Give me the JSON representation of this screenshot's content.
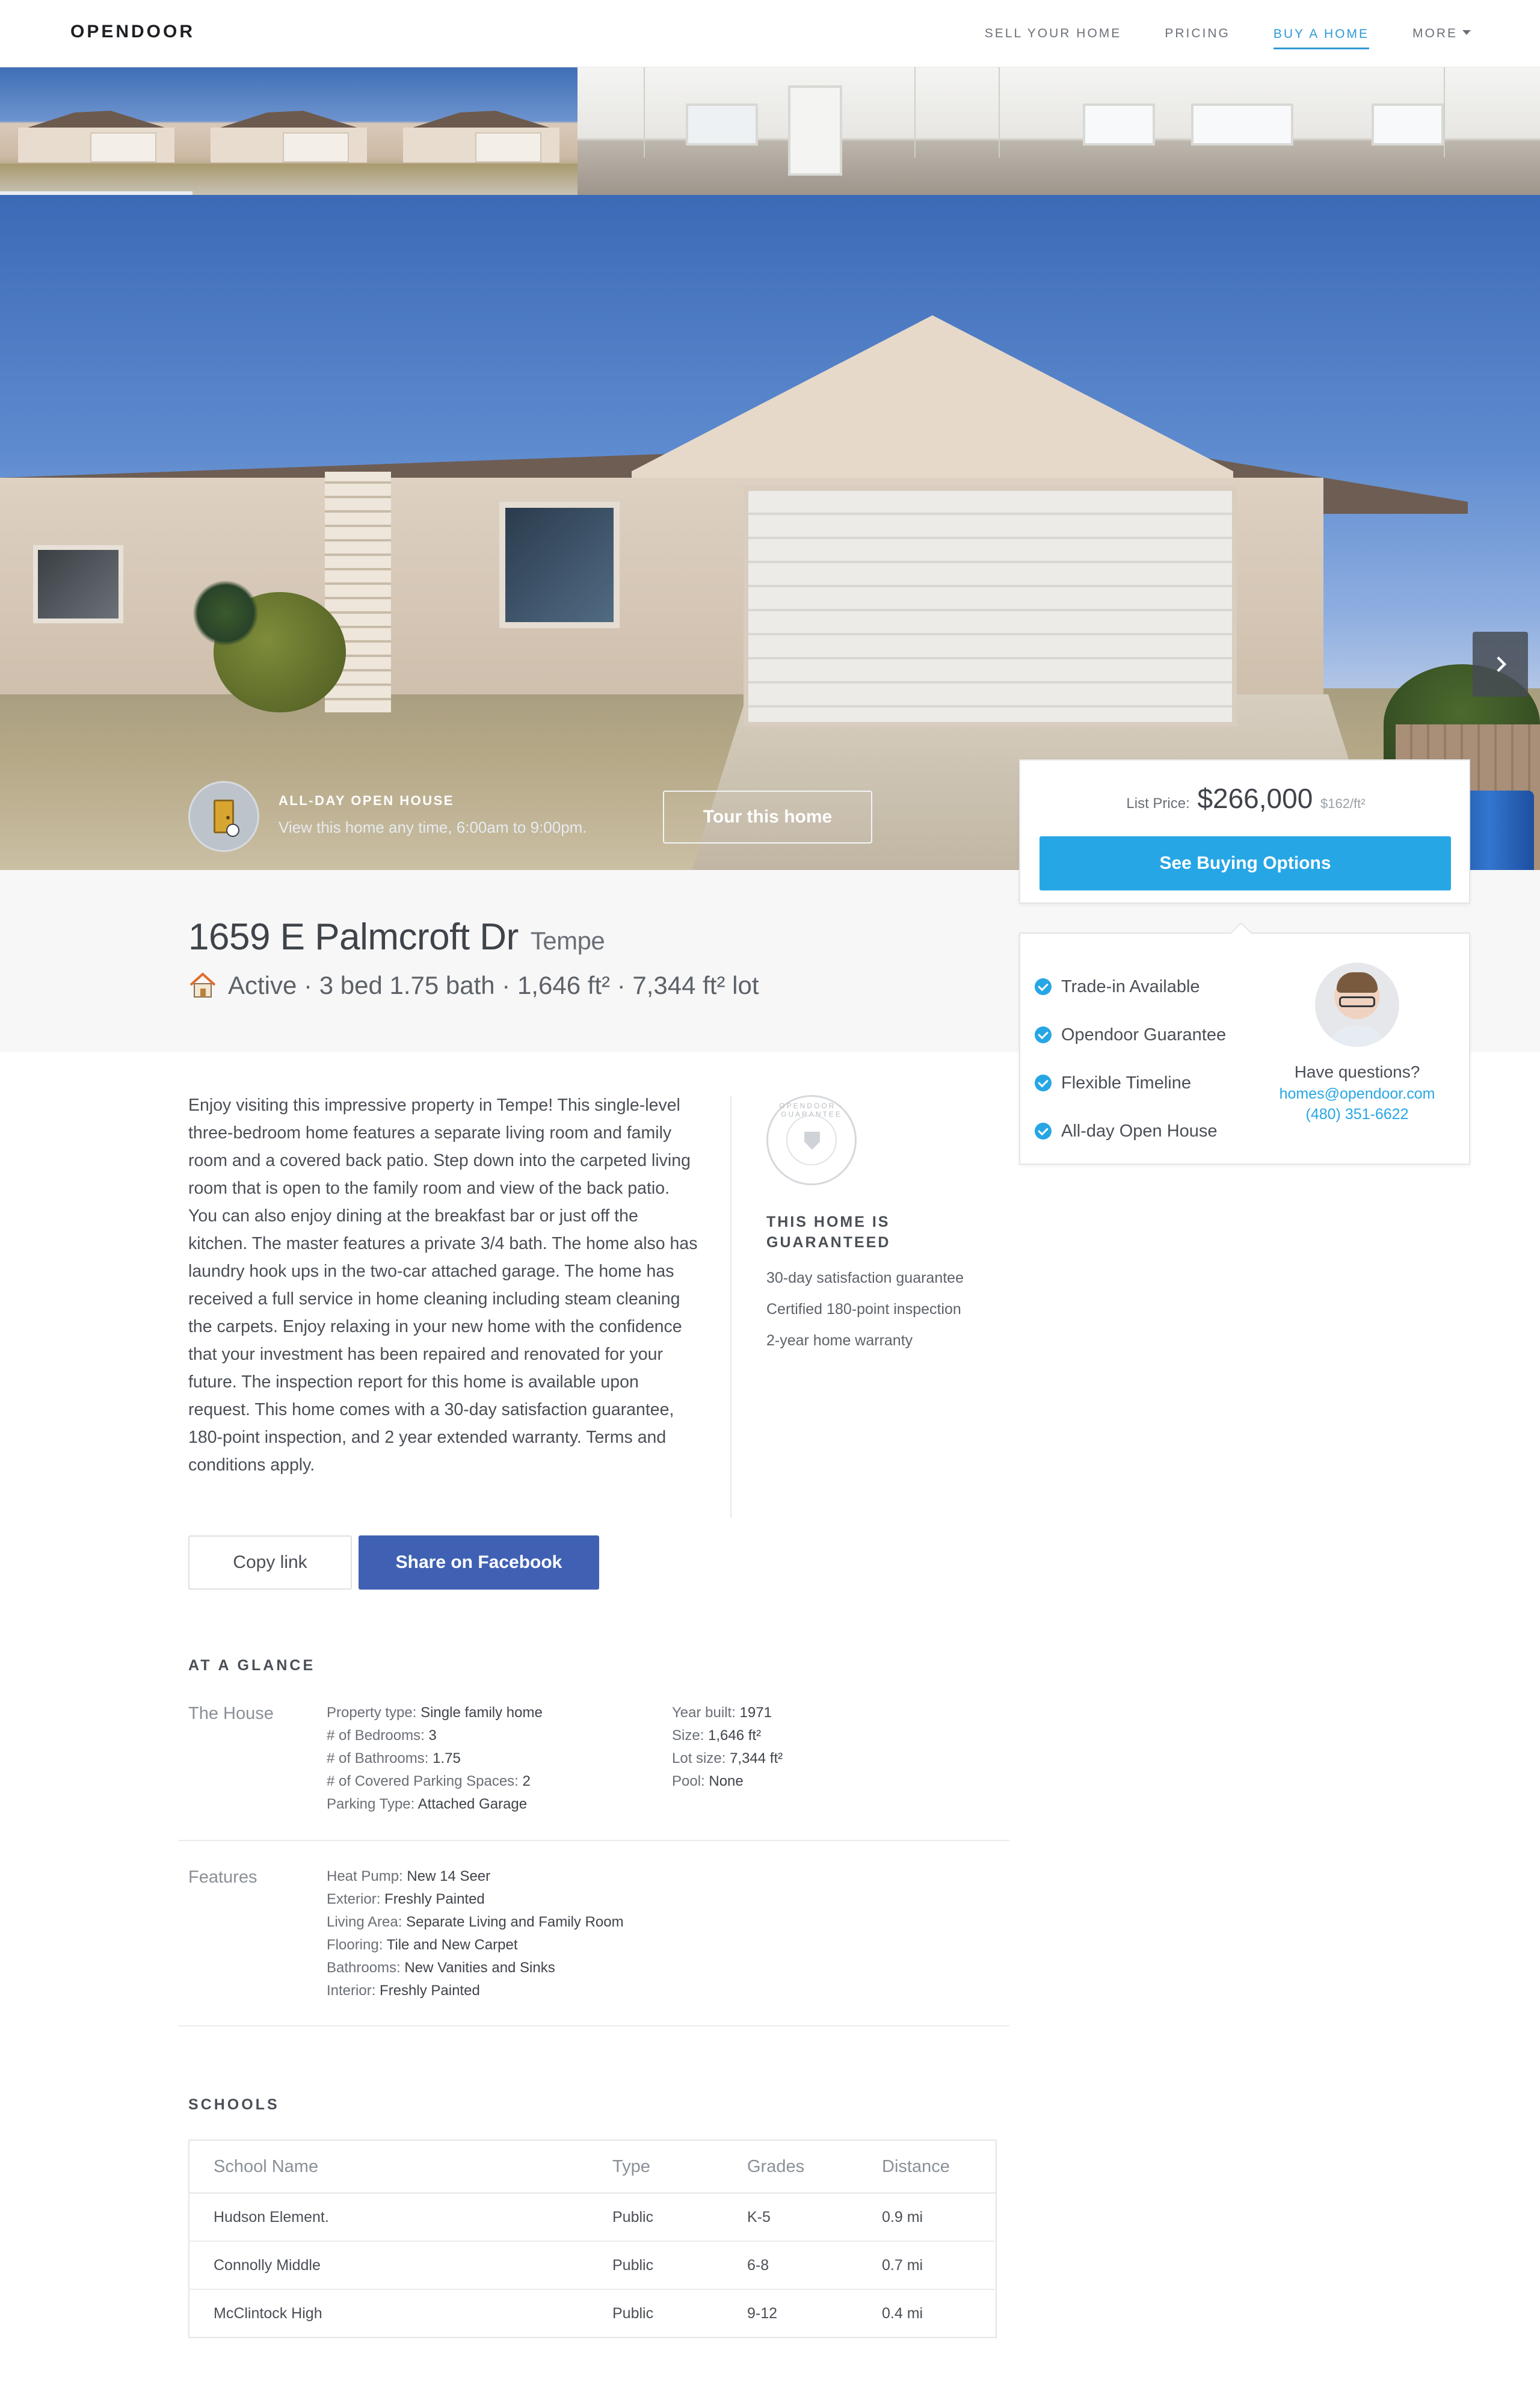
{
  "nav": {
    "logo": "OPENDOOR",
    "links": [
      "SELL YOUR HOME",
      "PRICING",
      "BUY A HOME",
      "MORE"
    ]
  },
  "open_house": {
    "title": "ALL-DAY OPEN HOUSE",
    "subtitle": "View this home any time, 6:00am to 9:00pm.",
    "tour_button": "Tour this home"
  },
  "listing": {
    "address": "1659 E Palmcroft Dr",
    "city": "Tempe",
    "status_line": "Active · 3 bed 1.75 bath · 1,646 ft² · 7,344 ft² lot"
  },
  "price_card": {
    "label": "List Price:",
    "price": "$266,000",
    "per_sqft": "$162/ft²",
    "button": "See Buying Options"
  },
  "features_card": {
    "items": [
      "Trade-in Available",
      "Opendoor Guarantee",
      "Flexible Timeline",
      "All-day Open House"
    ],
    "question": "Have questions?",
    "email": "homes@opendoor.com",
    "phone": "(480) 351-6622"
  },
  "description": "Enjoy visiting this impressive property in Tempe! This single-level three-bedroom home features a separate living room and family room and a covered back patio. Step down into the carpeted living room that is open to the family room and view of the back patio. You can also enjoy dining at the breakfast bar or just off the kitchen. The master features a private 3/4 bath. The home also has laundry hook ups in the two-car attached garage. The home has received a full service in home cleaning including steam cleaning the carpets. Enjoy relaxing in your new home with the confidence that your investment has been repaired and renovated for your future. The inspection report for this home is available upon request. This home comes with a 30-day satisfaction guarantee, 180-point inspection, and 2 year extended warranty. Terms and conditions apply.",
  "guarantee": {
    "seal_text": "OPENDOOR · GUARANTEE",
    "title": "THIS HOME IS GUARANTEED",
    "items": [
      "30-day satisfaction guarantee",
      "Certified 180-point inspection",
      "2-year home warranty"
    ]
  },
  "share": {
    "copy_link": "Copy link",
    "facebook": "Share on Facebook"
  },
  "at_a_glance": {
    "heading": "AT A GLANCE",
    "house_label": "The House",
    "house_left": [
      {
        "k": "Property type:",
        "v": "Single family home"
      },
      {
        "k": "# of Bedrooms:",
        "v": "3"
      },
      {
        "k": "# of Bathrooms:",
        "v": "1.75"
      },
      {
        "k": "# of Covered Parking Spaces:",
        "v": "2"
      },
      {
        "k": "Parking Type:",
        "v": "Attached Garage"
      }
    ],
    "house_right": [
      {
        "k": "Year built:",
        "v": "1971"
      },
      {
        "k": "Size:",
        "v": "1,646 ft²"
      },
      {
        "k": "Lot size:",
        "v": "7,344 ft²"
      },
      {
        "k": "Pool:",
        "v": "None"
      }
    ],
    "features_label": "Features",
    "features": [
      {
        "k": "Heat Pump:",
        "v": "New 14 Seer"
      },
      {
        "k": "Exterior:",
        "v": "Freshly Painted"
      },
      {
        "k": "Living Area:",
        "v": "Separate Living and Family Room"
      },
      {
        "k": "Flooring:",
        "v": "Tile and New Carpet"
      },
      {
        "k": "Bathrooms:",
        "v": "New Vanities and Sinks"
      },
      {
        "k": "Interior:",
        "v": "Freshly Painted"
      }
    ]
  },
  "schools": {
    "heading": "SCHOOLS",
    "columns": [
      "School Name",
      "Type",
      "Grades",
      "Distance"
    ],
    "rows": [
      [
        "Hudson Element.",
        "Public",
        "K-5",
        "0.9 mi"
      ],
      [
        "Connolly Middle",
        "Public",
        "6-8",
        "0.7 mi"
      ],
      [
        "McClintock High",
        "Public",
        "9-12",
        "0.4 mi"
      ]
    ]
  },
  "colors": {
    "accent_blue": "#27a6e5",
    "facebook_blue": "#4061b3",
    "nav_active": "#2e9ad6"
  }
}
